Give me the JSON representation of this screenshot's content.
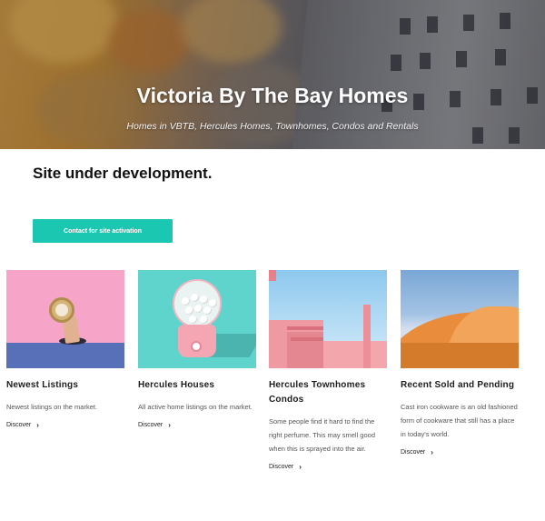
{
  "hero": {
    "title": "Victoria By The Bay Homes",
    "subtitle": "Homes in VBTB, Hercules Homes, Townhomes, Condos and Rentals"
  },
  "notice": "Site under development.",
  "cta_label": "Contact for site activation",
  "cards": [
    {
      "title": "Newest Listings",
      "description": "Newest listings on the market.",
      "link": "Discover"
    },
    {
      "title": "Hercules Houses",
      "description": "All active home listings on the market.",
      "link": "Discover"
    },
    {
      "title": "Hercules Townhomes Condos",
      "description": "Some people find it hard to find the right perfume. This may smell good when this is sprayed into the air.",
      "link": "Discover"
    },
    {
      "title": "Recent Sold and Pending",
      "description": "Cast iron cookware is an old fashioned form of cookware that still has a place in today's world.",
      "link": "Discover"
    }
  ],
  "colors": {
    "accent": "#1cc7b1"
  }
}
